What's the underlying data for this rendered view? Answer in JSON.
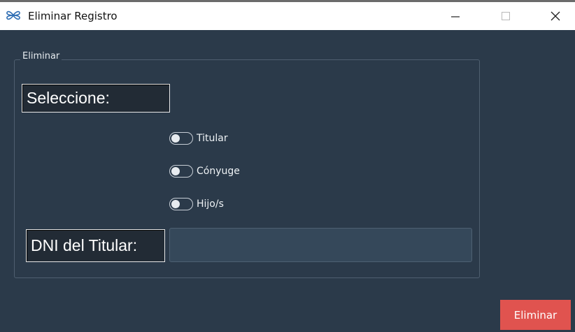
{
  "window": {
    "title": "Eliminar Registro",
    "icon": "app-logo-icon",
    "controls": [
      "minimize-icon",
      "maximize-icon",
      "close-icon"
    ]
  },
  "group": {
    "label": "Eliminar"
  },
  "form": {
    "select_label": "Seleccione:",
    "options": [
      {
        "label": "Titular",
        "checked": false
      },
      {
        "label": "Cónyuge",
        "checked": false
      },
      {
        "label": "Hijo/s",
        "checked": false
      }
    ],
    "dni_label": "DNI del Titular:",
    "dni_value": ""
  },
  "actions": {
    "delete_label": "Eliminar"
  },
  "colors": {
    "background": "#2b3a4a",
    "delete_button": "#e0534f",
    "input_bg": "#35485a"
  }
}
